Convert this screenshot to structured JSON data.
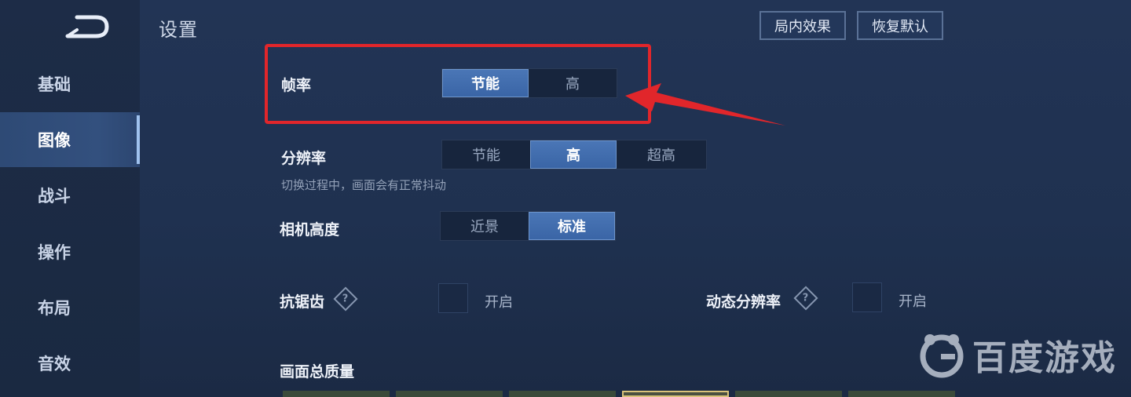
{
  "title": "设置",
  "sidebar": {
    "items": [
      {
        "label": "基础"
      },
      {
        "label": "图像",
        "active": true
      },
      {
        "label": "战斗"
      },
      {
        "label": "操作"
      },
      {
        "label": "布局"
      },
      {
        "label": "音效"
      }
    ]
  },
  "top_buttons": {
    "effects": "局内效果",
    "reset": "恢复默认"
  },
  "settings": {
    "frame_rate": {
      "label": "帧率",
      "options": [
        "节能",
        "高"
      ],
      "selected": "节能"
    },
    "resolution": {
      "label": "分辨率",
      "options": [
        "节能",
        "高",
        "超高"
      ],
      "selected": "高",
      "hint": "切换过程中，画面会有正常抖动"
    },
    "camera_height": {
      "label": "相机高度",
      "options": [
        "近景",
        "标准"
      ],
      "selected": "标准"
    },
    "anti_aliasing": {
      "label": "抗锯齿",
      "toggle_label": "开启",
      "checked": false,
      "help": "?"
    },
    "dynamic_resolution": {
      "label": "动态分辨率",
      "toggle_label": "开启",
      "checked": false,
      "help": "?"
    },
    "overall_quality": {
      "label": "画面总质量"
    }
  },
  "watermark": {
    "text": "百度游戏"
  },
  "colors": {
    "highlight": "#e1262b",
    "accent": "#4a76b6"
  }
}
